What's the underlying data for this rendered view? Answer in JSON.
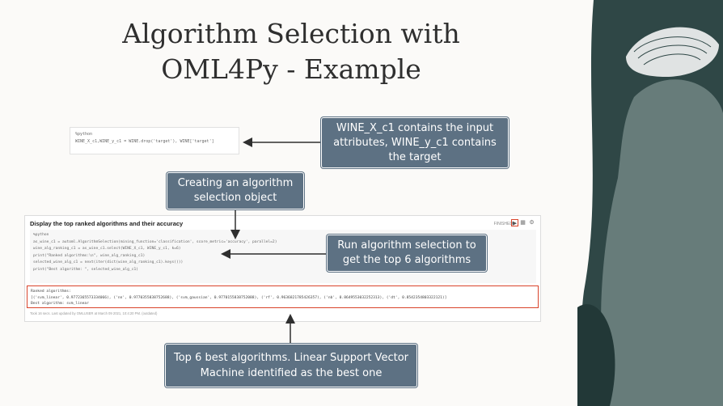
{
  "title_line1": "Algorithm Selection with",
  "title_line2": "OML4Py - Example",
  "code_cell1": {
    "line1": "%python",
    "line2": "WINE_X_c1,WINE_y_c1 = WINE.drop('target'), WINE['target']"
  },
  "callouts": {
    "inputs": "WINE_X_c1 contains the input attributes, WINE_y_c1 contains the target",
    "creating": "Creating an algorithm selection object",
    "run": "Run algorithm selection to get the top 6 algorithms",
    "best": "Top 6 best algorithms. Linear Support Vector Machine identified as the best one"
  },
  "notebook": {
    "title": "Display the top ranked algorithms and their accuracy",
    "status": "FINISHED",
    "code_lines": [
      "%python",
      "",
      "as_wine_c1 = automl.AlgorithmSelection(mining_function='classification', score_metric='accuracy', parallel=2)",
      "",
      "wine_alg_ranking_c1 = as_wine_c1.select(WINE_X_c1, WINE_y_c1, k=6)",
      "",
      "print(\"Ranked algorithms:\\n\", wine_alg_ranking_c1)",
      "",
      "selected_wine_alg_c1 = next(iter(dict(wine_alg_ranking_c1).keys()))",
      "print(\"Best algorithm: \", selected_wine_alg_c1)"
    ],
    "output_lines": [
      "Ranked algorithms:",
      "[('svm_linear', 0.9772365573334066), ('nn', 0.9770355838752688), ('svm_gaussian', 0.9770155838752088), ('rf', 0.9636821785426357), ('nb', 0.8649553032252313), ('dt', 0.8542354803322121)]",
      "Best algorithm:  svm_linear"
    ],
    "footer": "Took 16 secs. Last updated by OMLUSER at March 09 2021, 10:4:20 PM. (outdated)"
  },
  "icons": {
    "run": "play-icon",
    "table": "table-icon",
    "settings": "gear-icon"
  },
  "colors": {
    "callout_bg": "#5d7183",
    "highlight": "#d9442b",
    "deco_dark": "#2f4746"
  }
}
